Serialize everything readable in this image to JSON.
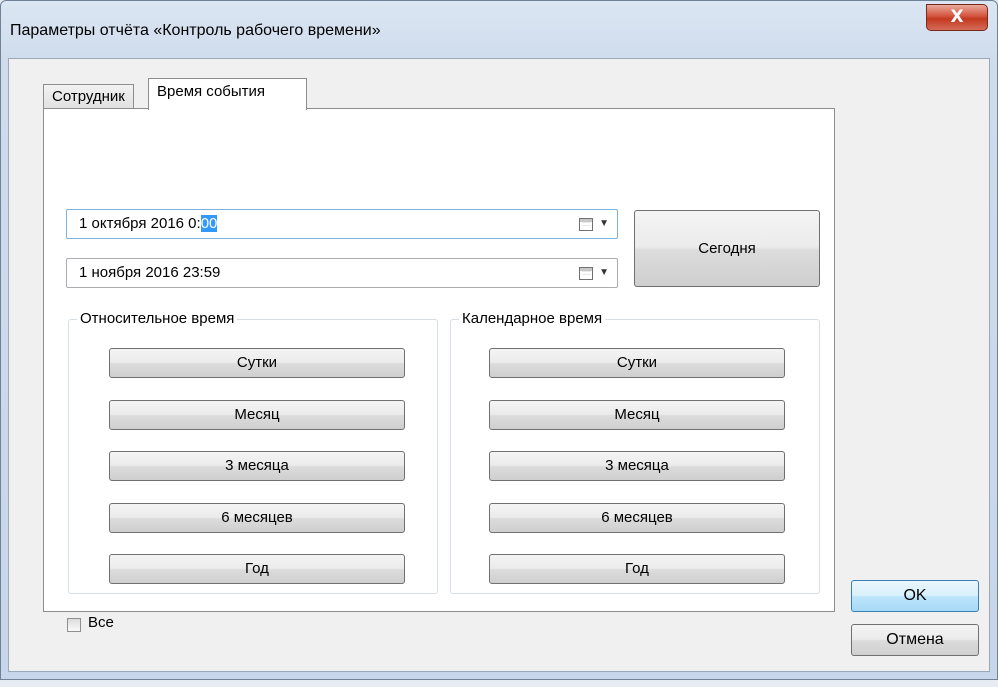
{
  "window": {
    "title": "Параметры отчёта «Контроль рабочего времени»",
    "close_label": "X"
  },
  "tabs": [
    {
      "label": "Сотрудник",
      "selected": false
    },
    {
      "label": "Время события",
      "selected": true
    }
  ],
  "date_from": {
    "prefix": "1  октября  2016   0:",
    "selected_part": "00"
  },
  "date_to": {
    "value": "1  ноября   2016 23:59"
  },
  "today_label": "Сегодня",
  "relative_group": {
    "label": "Относительное время",
    "buttons": [
      "Сутки",
      "Месяц",
      "3 месяца",
      "6 месяцев",
      "Год"
    ]
  },
  "calendar_group": {
    "label": "Календарное время",
    "buttons": [
      "Сутки",
      "Месяц",
      "3 месяца",
      "6 месяцев",
      "Год"
    ]
  },
  "all_checkbox": {
    "label": "Все",
    "checked": false
  },
  "ok_label": "OK",
  "cancel_label": "Отмена",
  "colors": {
    "selection": "#3399ff",
    "close_button": "#c3391f"
  },
  "icons": [
    "calendar-icon",
    "chevron-down-icon",
    "close-icon"
  ]
}
